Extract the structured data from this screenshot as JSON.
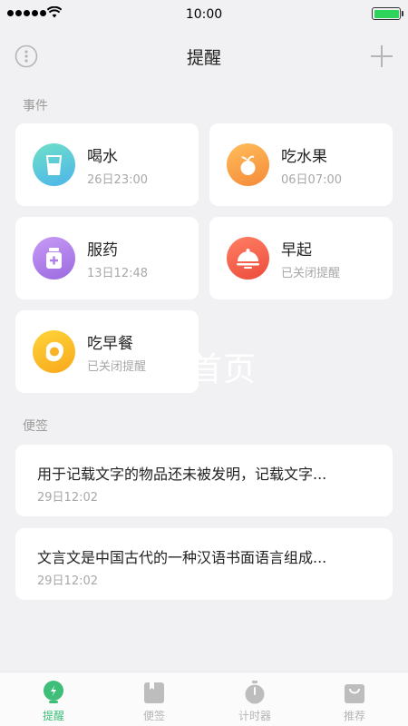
{
  "status_bar": {
    "time": "10:00"
  },
  "nav": {
    "title": "提醒"
  },
  "events": {
    "section_label": "事件",
    "items": [
      {
        "title": "喝水",
        "subtitle": "26日23:00",
        "icon": "water-glass-icon",
        "color": "#5cc7e6"
      },
      {
        "title": "吃水果",
        "subtitle": "06日07:00",
        "icon": "fruit-icon",
        "color": "#f7a047"
      },
      {
        "title": "服药",
        "subtitle": "13日12:48",
        "icon": "medicine-bottle-icon",
        "color": "#b07de8"
      },
      {
        "title": "早起",
        "subtitle": "已关闭提醒",
        "icon": "breakfast-dome-icon",
        "color": "#f2604a"
      },
      {
        "title": "吃早餐",
        "subtitle": "已关闭提醒",
        "icon": "fried-egg-icon",
        "color": "#fbbf2a"
      }
    ]
  },
  "watermark": "时首页",
  "notes": {
    "section_label": "便签",
    "items": [
      {
        "text": "用于记载文字的物品还未被发明，记载文字...",
        "date": "29日12:02"
      },
      {
        "text": "文言文是中国古代的一种汉语书面语言组成...",
        "date": "29日12:02"
      }
    ]
  },
  "tabbar": {
    "items": [
      {
        "label": "提醒",
        "icon": "reminder-bulb-icon",
        "active": true
      },
      {
        "label": "便签",
        "icon": "notepad-icon",
        "active": false
      },
      {
        "label": "计时器",
        "icon": "stopwatch-icon",
        "active": false
      },
      {
        "label": "推荐",
        "icon": "shopping-bag-icon",
        "active": false
      }
    ],
    "active_color": "#3fbe7a",
    "inactive_color": "#b5b5b5"
  }
}
